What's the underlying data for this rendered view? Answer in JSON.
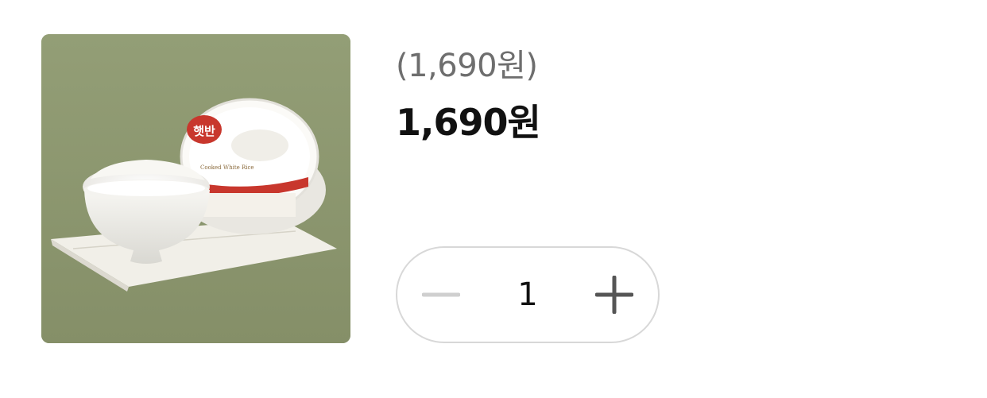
{
  "product": {
    "image_alt": "햇반 Cooked White Rice",
    "image_brand_text": "햇반",
    "original_price": "(1,690원)",
    "sale_price": "1,690원"
  },
  "quantity": {
    "value": "1",
    "minus_icon": "minus-icon",
    "plus_icon": "plus-icon",
    "minus_color": "#cfcfcf",
    "plus_color": "#555555"
  }
}
